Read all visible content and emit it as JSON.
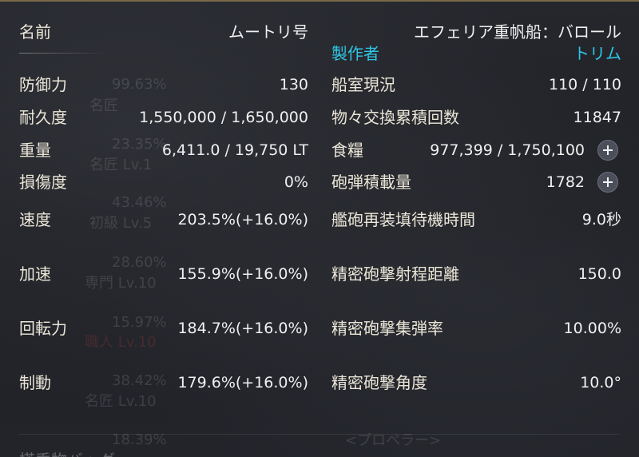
{
  "ghost": {
    "percents": [
      "99.63%",
      "23.35%",
      "43.46%",
      "28.60%",
      "15.97%",
      "38.42%",
      "18.39%"
    ],
    "levels": [
      "名匠",
      "名匠 Lv.1",
      "初級 Lv.5",
      "専門 Lv.10",
      "職人 Lv.10",
      "名匠 Lv.10"
    ],
    "propeller": "<プロペラー>",
    "bottom_label": "搭乗物バッグ"
  },
  "ship": {
    "name_label": "名前",
    "name_value": "ムートリ号",
    "type": "エフェリア重帆船：バロール",
    "maker_label": "製作者",
    "maker_value": "トリム"
  },
  "left_stats": [
    {
      "label": "防御力",
      "value": "130"
    },
    {
      "label": "耐久度",
      "value": "1,550,000 / 1,650,000"
    },
    {
      "label": "重量",
      "value": "6,411.0 / 19,750 LT"
    },
    {
      "label": "損傷度",
      "value": "0%"
    },
    {
      "label": "速度",
      "value": "203.5%(+16.0%)"
    },
    {
      "label": "加速",
      "value": "155.9%(+16.0%)"
    },
    {
      "label": "回転力",
      "value": "184.7%(+16.0%)"
    },
    {
      "label": "制動",
      "value": "179.6%(+16.0%)"
    }
  ],
  "right_stats": [
    {
      "label": "船室現況",
      "value": "110 / 110"
    },
    {
      "label": "物々交換累積回数",
      "value": "11847"
    },
    {
      "label": "食糧",
      "value": "977,399 / 1,750,100"
    },
    {
      "label": "砲弾積載量",
      "value": "1782"
    },
    {
      "label": "艦砲再装填待機時間",
      "value": "9.0秒"
    },
    {
      "label": "精密砲撃射程距離",
      "value": "150.0"
    },
    {
      "label": "精密砲撃集弾率",
      "value": "10.00%"
    },
    {
      "label": "精密砲撃角度",
      "value": "10.0°"
    }
  ],
  "icons": {
    "add_food": "plus-icon",
    "add_shells": "plus-icon"
  },
  "colors": {
    "accent_cyan": "#2fc6e6",
    "frame_gold": "#7a6a48",
    "text": "#ece6d8"
  }
}
